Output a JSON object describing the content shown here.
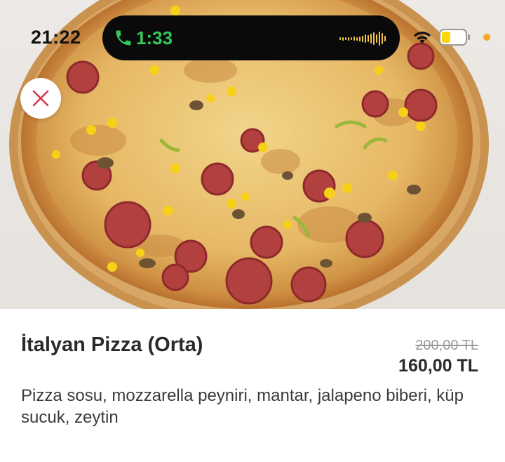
{
  "status": {
    "time": "21:22",
    "call_time": "1:33",
    "icons": [
      "phone-icon",
      "waveform-icon",
      "wifi-icon",
      "battery-icon"
    ]
  },
  "colors": {
    "call_green": "#35c759",
    "close_red": "#d6364a",
    "battery_yellow": "#ffd60a",
    "indicator_orange": "#f5a623"
  },
  "product": {
    "image_alt": "pizza-image",
    "name": "İtalyan Pizza (Orta)",
    "old_price": "200,00 TL",
    "price": "160,00 TL",
    "description": "Pizza sosu, mozzarella peyniri, mantar, jalapeno biberi, küp sucuk, zeytin"
  }
}
